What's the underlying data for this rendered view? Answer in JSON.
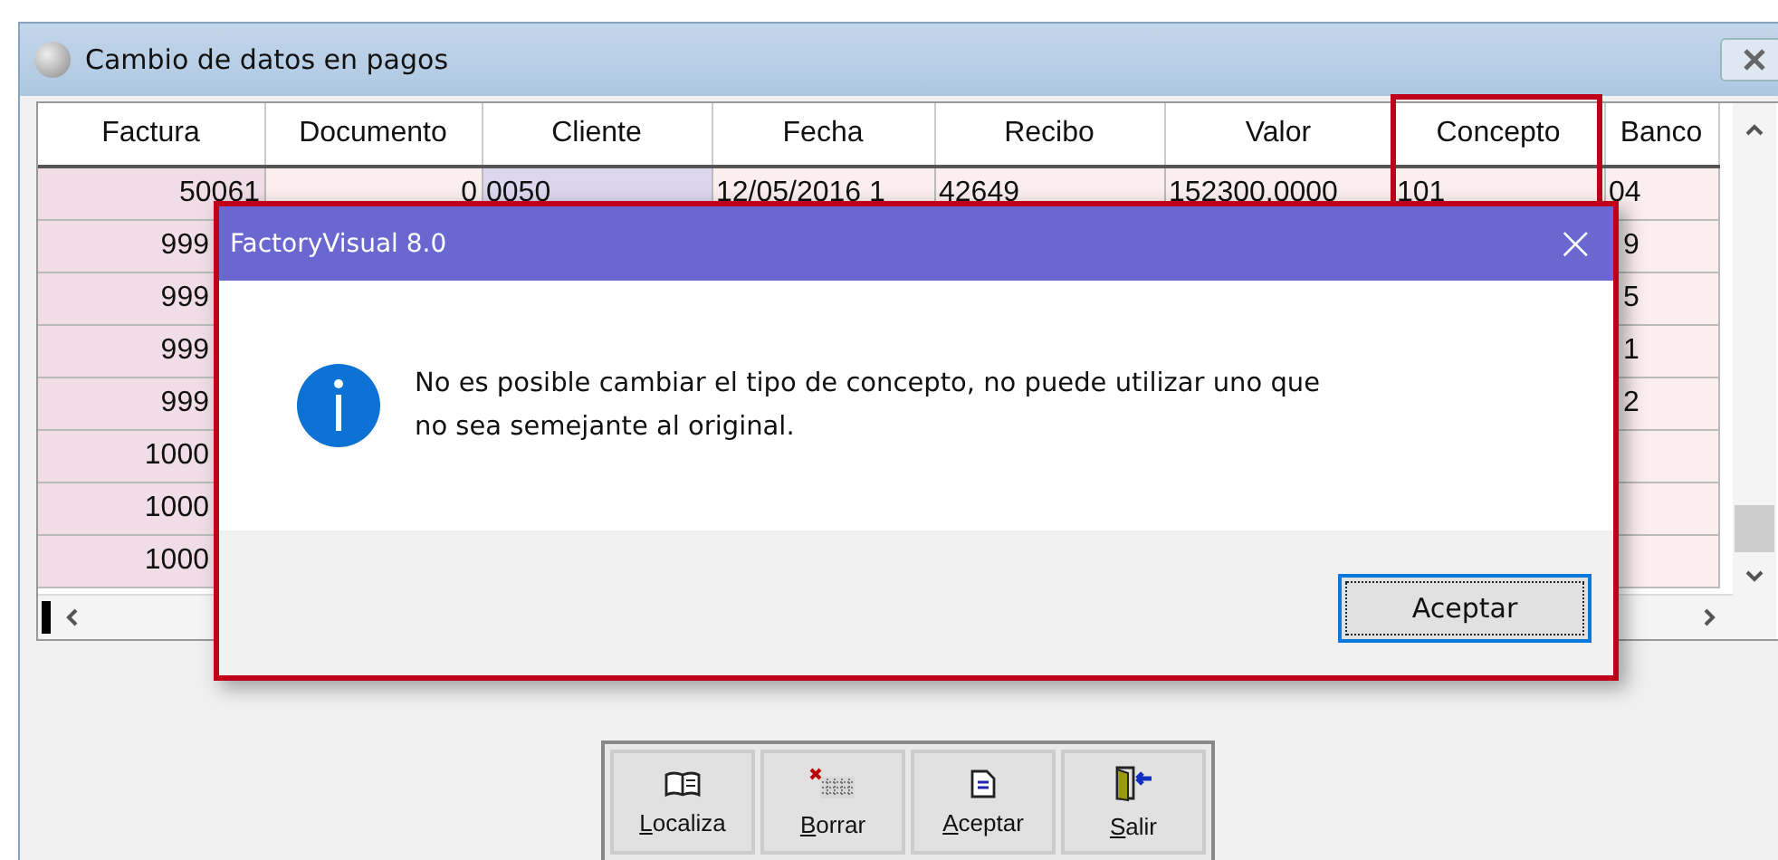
{
  "window": {
    "title": "Cambio de datos en pagos"
  },
  "table": {
    "columns": [
      "Factura",
      "Documento",
      "Cliente",
      "Fecha",
      "Recibo",
      "Valor",
      "Concepto",
      "Banco"
    ],
    "rows": [
      {
        "kind": "full",
        "cells": [
          "50061",
          "0",
          "0050",
          "12/05/2016 1",
          "42649",
          "152300.0000",
          "101",
          "04"
        ]
      },
      {
        "kind": "covered",
        "cells": [
          "999",
          "9"
        ]
      },
      {
        "kind": "covered",
        "cells": [
          "999",
          "5"
        ]
      },
      {
        "kind": "covered",
        "cells": [
          "999",
          "1"
        ]
      },
      {
        "kind": "covered",
        "cells": [
          "999",
          "2"
        ]
      },
      {
        "kind": "covered",
        "cells": [
          "1000"
        ]
      },
      {
        "kind": "covered",
        "cells": [
          "1000"
        ]
      },
      {
        "kind": "covered",
        "cells": [
          "1000"
        ]
      }
    ]
  },
  "toolbar": [
    {
      "kind": "find",
      "label": "Localiza"
    },
    {
      "kind": "delete",
      "label": "Borrar"
    },
    {
      "kind": "accept",
      "label": "Aceptar"
    },
    {
      "kind": "exit",
      "label": "Salir"
    }
  ],
  "dialog": {
    "title": "FactoryVisual 8.0",
    "close": "×",
    "message": "No es posible cambiar el tipo de concepto, no puede utilizar uno que no sea semejante al original.",
    "button": "Aceptar"
  }
}
